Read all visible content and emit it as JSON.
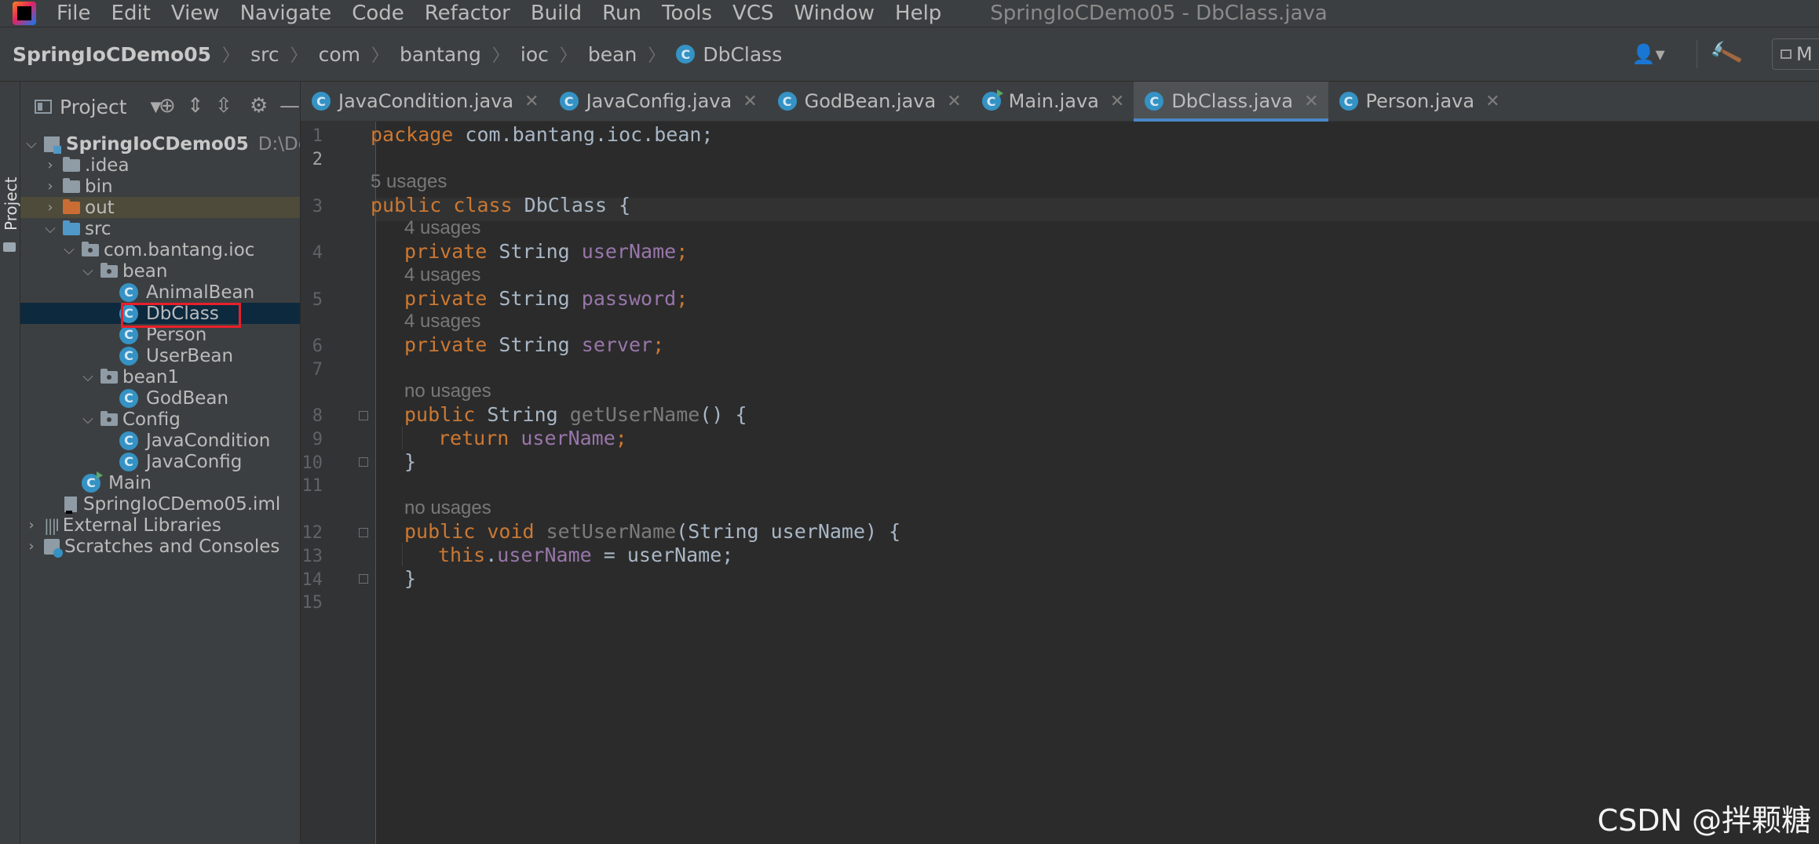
{
  "menubar": {
    "items": [
      {
        "label": "File"
      },
      {
        "label": "Edit"
      },
      {
        "label": "View"
      },
      {
        "label": "Navigate"
      },
      {
        "label": "Code"
      },
      {
        "label": "Refactor"
      },
      {
        "label": "Build"
      },
      {
        "label": "Run"
      },
      {
        "label": "Tools"
      },
      {
        "label": "VCS"
      },
      {
        "label": "Window"
      },
      {
        "label": "Help"
      }
    ],
    "window_title": "SpringIoCDemo05 - DbClass.java"
  },
  "breadcrumbs": [
    "SpringIoCDemo05",
    "src",
    "com",
    "bantang",
    "ioc",
    "bean",
    "DbClass"
  ],
  "toolbar": {
    "run_config_label": "M"
  },
  "toolstrip": {
    "project_label": "Project"
  },
  "project_panel": {
    "title": "Project",
    "tree": {
      "root_name": "SpringIoCDemo05",
      "root_path": "D:\\DevelopApplica",
      "idea": ".idea",
      "bin": "bin",
      "out": "out",
      "src": "src",
      "pkg": "com.bantang.ioc",
      "bean": "bean",
      "animal_bean": "AnimalBean",
      "db_class": "DbClass",
      "person": "Person",
      "user_bean": "UserBean",
      "bean1": "bean1",
      "god_bean": "GodBean",
      "config": "Config",
      "java_condition": "JavaCondition",
      "java_config": "JavaConfig",
      "main": "Main",
      "iml": "SpringIoCDemo05.iml",
      "external_libraries": "External Libraries",
      "scratches": "Scratches and Consoles"
    }
  },
  "editor": {
    "tabs": [
      {
        "label": "JavaCondition.java"
      },
      {
        "label": "JavaConfig.java"
      },
      {
        "label": "GodBean.java"
      },
      {
        "label": "Main.java"
      },
      {
        "label": "DbClass.java",
        "active": true
      },
      {
        "label": "Person.java"
      }
    ],
    "line_numbers": [
      "1",
      "2",
      "3",
      "4",
      "5",
      "6",
      "7",
      "8",
      "9",
      "10",
      "11",
      "12",
      "13",
      "14",
      "15"
    ],
    "code": {
      "l1_kw": "package",
      "l1_rest": " com.bantang.ioc.bean;",
      "u3": "5 usages",
      "l3_kw": "public class",
      "l3_rest": " DbClass {",
      "u4": "4 usages",
      "l4_kw": "private",
      "l4_type": " String ",
      "l4_fld": "userName",
      "l4_end": ";",
      "u5": "4 usages",
      "l5_kw": "private",
      "l5_type": " String ",
      "l5_fld": "password",
      "l5_end": ";",
      "u6": "4 usages",
      "l6_kw": "private",
      "l6_type": " String ",
      "l6_fld": "server",
      "l6_end": ";",
      "u8": "no usages",
      "l8_kw": "public",
      "l8_type": " String ",
      "l8_fn": "getUserName",
      "l8_end": "() {",
      "l9_kw": "return",
      "l9_fld": " userName",
      "l9_end": ";",
      "l10": "}",
      "u12": "no usages",
      "l12_kw": "public void",
      "l12_fn": " setUserName",
      "l12_end": "(String userName) {",
      "l13_kw": "this",
      "l13_dot": ".",
      "l13_fld": "userName",
      "l13_end": " = userName;",
      "l14": "}"
    }
  },
  "watermark": "CSDN @拌颗糖"
}
